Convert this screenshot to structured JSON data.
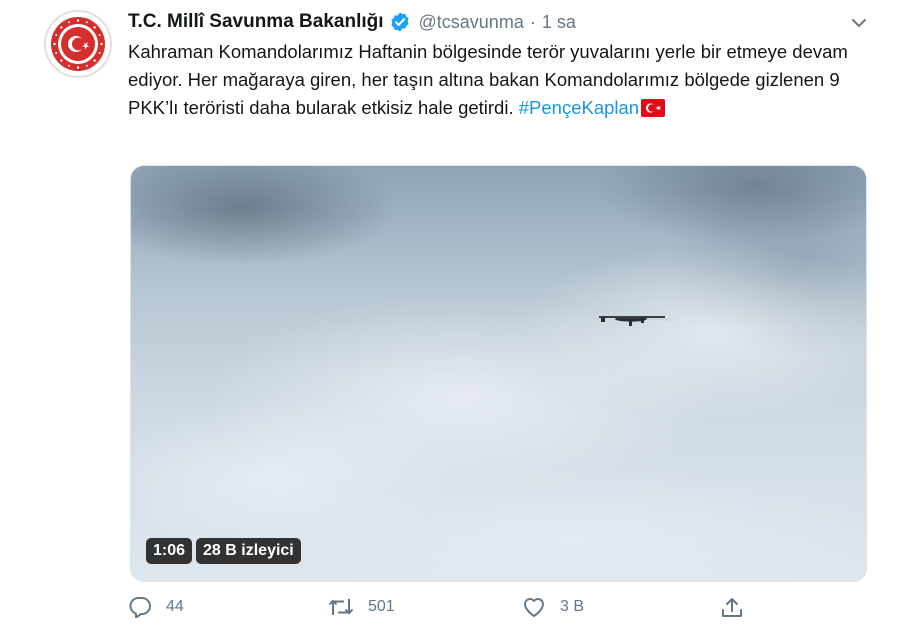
{
  "account": {
    "display_name": "T.C. Millî Savunma Bakanlığı",
    "handle": "@tcsavunma",
    "separator": "·",
    "time": "1 sa"
  },
  "tweet": {
    "text": "Kahraman Komandolarımız Haftanin bölgesinde terör yuvalarını yerle bir etmeye devam ediyor. Her mağaraya giren, her taşın altına bakan Komandolarımız bölgede gizlenen 9 PKK’lı teröristi daha bularak etkisiz hale getirdi. ",
    "hashtag": "#PençeKaplan"
  },
  "video": {
    "duration": "1:06",
    "views": "28 B izleyici"
  },
  "actions": {
    "reply_count": "44",
    "retweet_count": "501",
    "like_count": "3 B"
  },
  "colors": {
    "link": "#1b95e0",
    "verified": "#1da1f2",
    "muted": "#657786",
    "emblem_red": "#d32f2f"
  },
  "icons": [
    "ministry-emblem-icon",
    "verified-badge-icon",
    "chevron-down-icon",
    "turkey-flag-icon",
    "reply-icon",
    "retweet-icon",
    "like-icon",
    "share-icon"
  ]
}
